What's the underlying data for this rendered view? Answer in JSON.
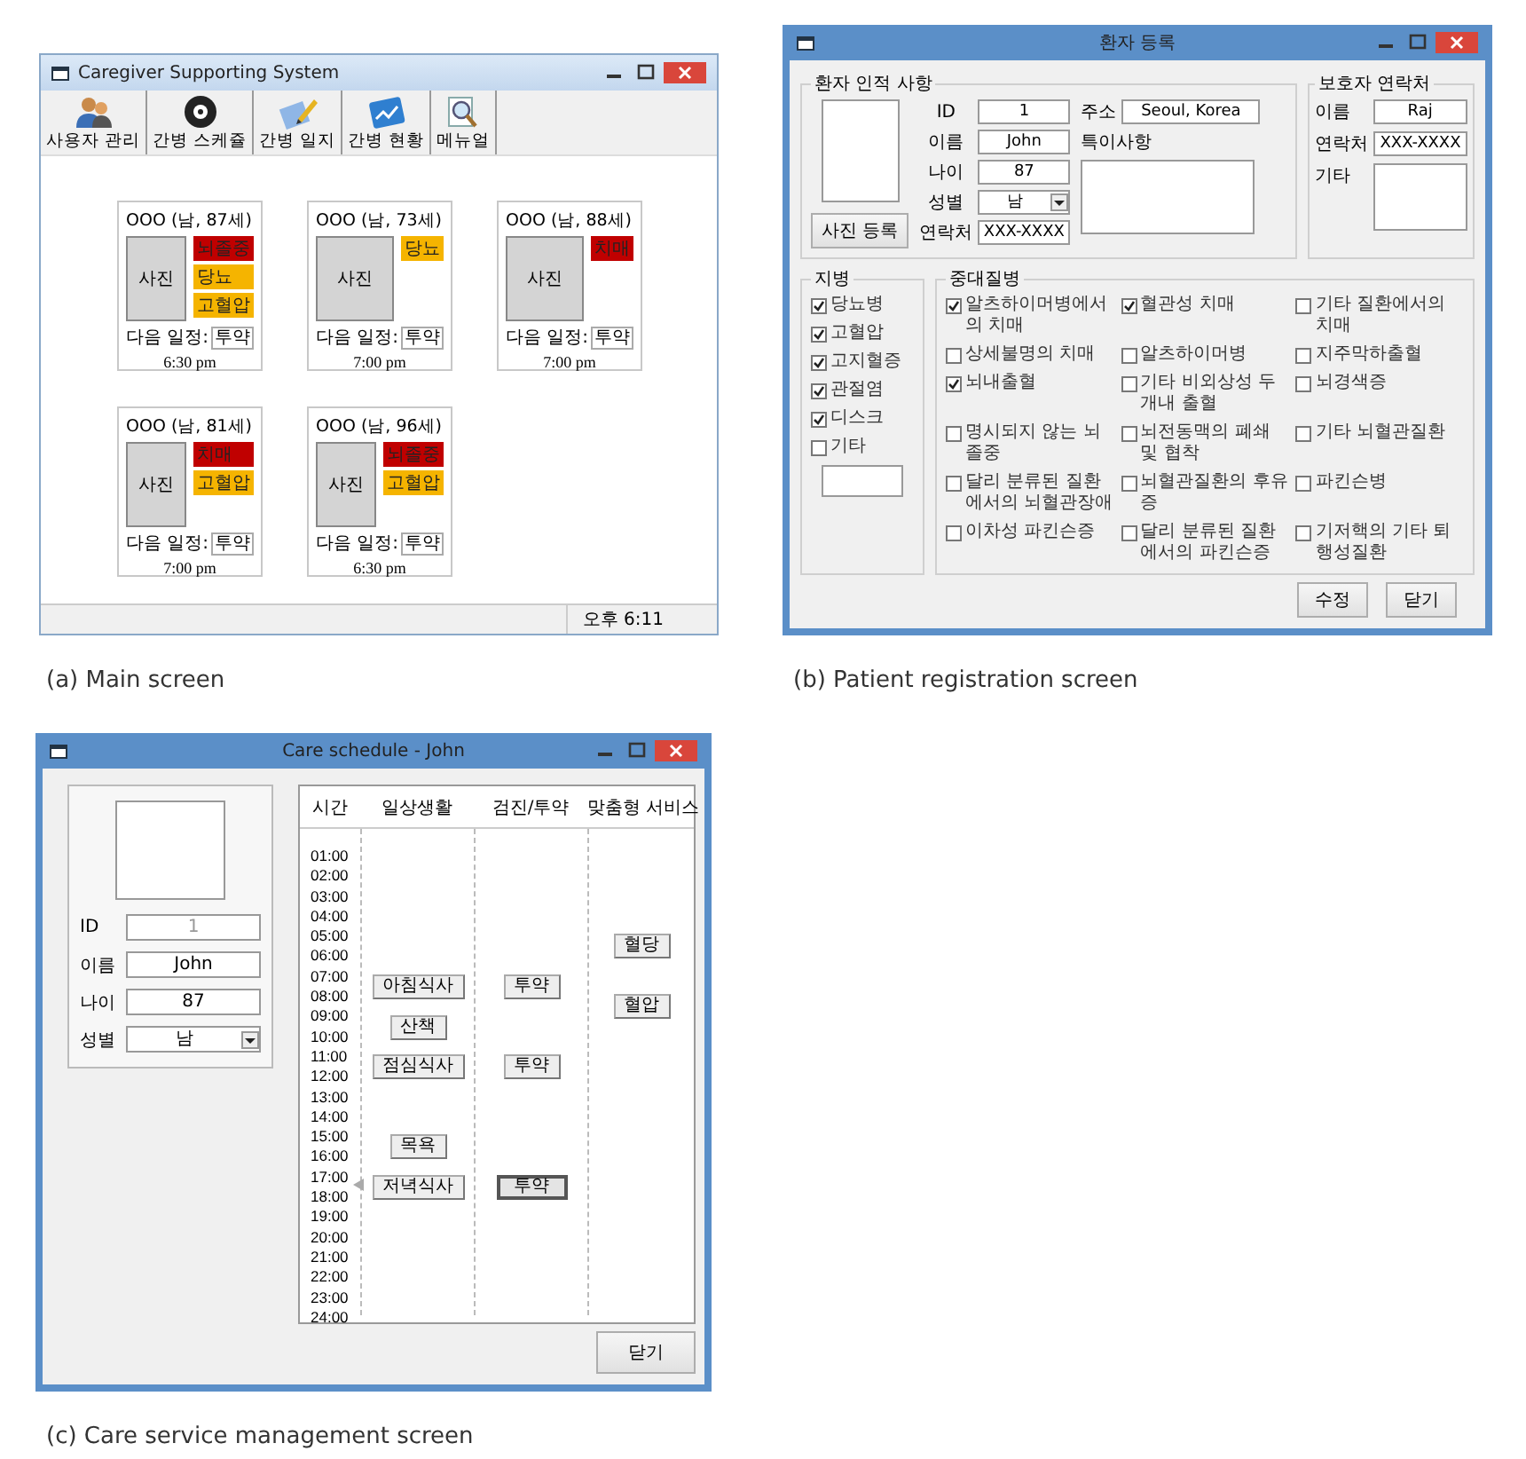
{
  "main_screen": {
    "window": {
      "title": "Caregiver Supporting System"
    },
    "toolbar": [
      {
        "label": "사용자 관리"
      },
      {
        "label": "간병 스케쥴"
      },
      {
        "label": "간병 일지"
      },
      {
        "label": "간병 현황"
      },
      {
        "label": "메뉴얼"
      }
    ],
    "patients": [
      {
        "name": "OOO (남, 87세)",
        "photo": "사진",
        "tags": [
          {
            "label": "뇌졸중",
            "color": "#c00000"
          },
          {
            "label": "당뇨",
            "color": "#f5b400"
          },
          {
            "label": "고혈압",
            "color": "#f5b400"
          }
        ],
        "next_label": "다음 일정:",
        "next_value": "투약",
        "next_time": "6:30 pm"
      },
      {
        "name": "OOO (남, 73세)",
        "photo": "사진",
        "tags": [
          {
            "label": "당뇨",
            "color": "#f5b400"
          }
        ],
        "next_label": "다음 일정:",
        "next_value": "투약",
        "next_time": "7:00 pm"
      },
      {
        "name": "OOO (남, 88세)",
        "photo": "사진",
        "tags": [
          {
            "label": "치매",
            "color": "#c00000"
          }
        ],
        "next_label": "다음 일정:",
        "next_value": "투약",
        "next_time": "7:00 pm"
      },
      {
        "name": "OOO (남, 81세)",
        "photo": "사진",
        "tags": [
          {
            "label": "치매",
            "color": "#c00000"
          },
          {
            "label": "고혈압",
            "color": "#f5b400"
          }
        ],
        "next_label": "다음 일정:",
        "next_value": "투약",
        "next_time": "7:00 pm"
      },
      {
        "name": "OOO (남, 96세)",
        "photo": "사진",
        "tags": [
          {
            "label": "뇌졸중",
            "color": "#c00000"
          },
          {
            "label": "고혈압",
            "color": "#f5b400"
          }
        ],
        "next_label": "다음 일정:",
        "next_value": "투약",
        "next_time": "6:30 pm"
      }
    ],
    "status_bar": "오후 6:11",
    "caption": "(a) Main screen"
  },
  "registration_screen": {
    "window": {
      "title": "환자 등록"
    },
    "personal": {
      "title": "환자 인적 사항",
      "photo_button": "사진 등록",
      "fields": [
        {
          "label": "ID",
          "value": "1"
        },
        {
          "label": "이름",
          "value": "John"
        },
        {
          "label": "나이",
          "value": "87"
        },
        {
          "label": "성별",
          "value": "남",
          "kind": "select"
        },
        {
          "label": "연락처",
          "value": "XXX-XXXX"
        }
      ],
      "address_label": "주소",
      "address": "Seoul, Korea",
      "notes_label": "특이사항"
    },
    "guardian": {
      "title": "보호자 연락처",
      "fields": [
        {
          "label": "이름",
          "value": "Raj"
        },
        {
          "label": "연락처",
          "value": "XXX-XXXX"
        }
      ],
      "other_label": "기타"
    },
    "chronic": {
      "title": "지병",
      "items": [
        {
          "label": "당뇨병",
          "checked": true
        },
        {
          "label": "고혈압",
          "checked": true
        },
        {
          "label": "고지혈증",
          "checked": true
        },
        {
          "label": "관절염",
          "checked": true
        },
        {
          "label": "디스크",
          "checked": true
        },
        {
          "label": "기타",
          "checked": false
        }
      ]
    },
    "major": {
      "title": "중대질병",
      "items": [
        {
          "label": "알츠하이머병에서의 치매",
          "checked": true
        },
        {
          "label": "혈관성 치매",
          "checked": true
        },
        {
          "label": "기타 질환에서의 치매",
          "checked": false
        },
        {
          "label": "상세불명의 치매",
          "checked": false
        },
        {
          "label": "알츠하이머병",
          "checked": false
        },
        {
          "label": "지주막하출혈",
          "checked": false
        },
        {
          "label": "뇌내출혈",
          "checked": true
        },
        {
          "label": "기타 비외상성 두개내 출혈",
          "checked": false
        },
        {
          "label": "뇌경색증",
          "checked": false
        },
        {
          "label": "명시되지 않는 뇌졸중",
          "checked": false
        },
        {
          "label": "뇌전동맥의 폐쇄 및 협착",
          "checked": false
        },
        {
          "label": "기타 뇌혈관질환",
          "checked": false
        },
        {
          "label": "달리 분류된 질환에서의 뇌혈관장애",
          "checked": false
        },
        {
          "label": "뇌혈관질환의 후유증",
          "checked": false
        },
        {
          "label": "파킨슨병",
          "checked": false
        },
        {
          "label": "이차성 파킨슨증",
          "checked": false
        },
        {
          "label": "달리 분류된 질환에서의 파킨슨증",
          "checked": false
        },
        {
          "label": "기저핵의 기타 퇴행성질환",
          "checked": false
        }
      ]
    },
    "buttons": [
      "수정",
      "닫기"
    ],
    "caption": "(b) Patient registration screen"
  },
  "schedule_screen": {
    "window": {
      "title": "Care schedule - John"
    },
    "fields": [
      {
        "label": "ID",
        "value": "1",
        "disabled": true
      },
      {
        "label": "이름",
        "value": "John",
        "disabled": false
      },
      {
        "label": "나이",
        "value": "87",
        "disabled": false
      },
      {
        "label": "성별",
        "value": "남",
        "disabled": false,
        "kind": "select"
      }
    ],
    "columns": [
      "시간",
      "일상생활",
      "검진/투약",
      "맞춤형 서비스"
    ],
    "rows": [
      {
        "time": "01:00",
        "current": false
      },
      {
        "time": "02:00",
        "current": false
      },
      {
        "time": "03:00",
        "current": false
      },
      {
        "time": "04:00",
        "current": false
      },
      {
        "time": "05:00",
        "current": false
      },
      {
        "time": "06:00",
        "current": false,
        "service": {
          "label": "혈당",
          "selected": false
        }
      },
      {
        "time": "07:00",
        "current": false
      },
      {
        "time": "08:00",
        "current": false,
        "daily": {
          "label": "아침식사",
          "selected": false
        },
        "checkup": {
          "label": "투약",
          "selected": false
        }
      },
      {
        "time": "09:00",
        "current": false,
        "service": {
          "label": "혈압",
          "selected": false
        }
      },
      {
        "time": "10:00",
        "current": false,
        "daily": {
          "label": "산책",
          "selected": false
        }
      },
      {
        "time": "11:00",
        "current": false
      },
      {
        "time": "12:00",
        "current": false,
        "daily": {
          "label": "점심식사",
          "selected": false
        },
        "checkup": {
          "label": "투약",
          "selected": false
        }
      },
      {
        "time": "13:00",
        "current": false
      },
      {
        "time": "14:00",
        "current": false
      },
      {
        "time": "15:00",
        "current": false
      },
      {
        "time": "16:00",
        "current": false,
        "daily": {
          "label": "목욕",
          "selected": false
        }
      },
      {
        "time": "17:00",
        "current": false
      },
      {
        "time": "18:00",
        "current": true,
        "daily": {
          "label": "저녁식사",
          "selected": false
        },
        "checkup": {
          "label": "투약",
          "selected": true
        }
      },
      {
        "time": "19:00",
        "current": false
      },
      {
        "time": "20:00",
        "current": false
      },
      {
        "time": "21:00",
        "current": false
      },
      {
        "time": "22:00",
        "current": false
      },
      {
        "time": "23:00",
        "current": false
      },
      {
        "time": "24:00",
        "current": false
      }
    ],
    "close_button": "닫기",
    "caption": "(c) Care service management screen"
  }
}
